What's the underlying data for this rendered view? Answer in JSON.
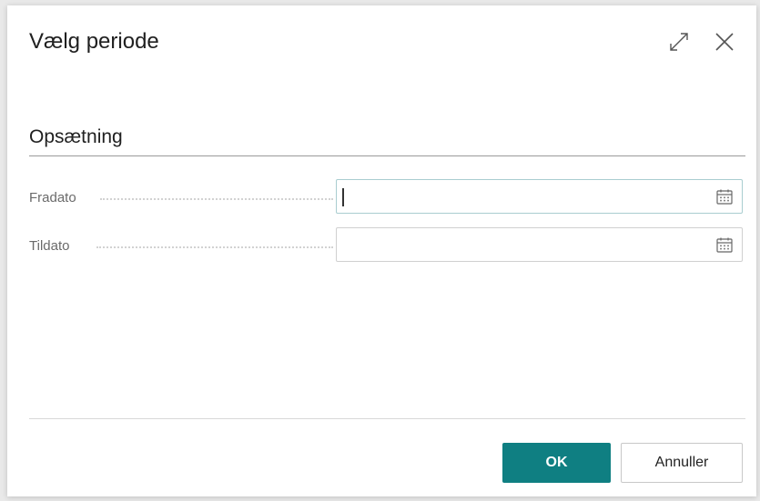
{
  "dialog": {
    "title": "Vælg periode",
    "expand_icon": "expand-icon",
    "close_icon": "close-icon"
  },
  "section": {
    "title": "Opsætning"
  },
  "fields": [
    {
      "label": "Fradato",
      "value": "",
      "icon": "calendar-icon",
      "focused": true
    },
    {
      "label": "Tildato",
      "value": "",
      "icon": "calendar-icon",
      "focused": false
    }
  ],
  "buttons": {
    "ok_label": "OK",
    "cancel_label": "Annuller"
  },
  "colors": {
    "primary": "#0f7f82",
    "focus_border": "#a9cdd0"
  }
}
